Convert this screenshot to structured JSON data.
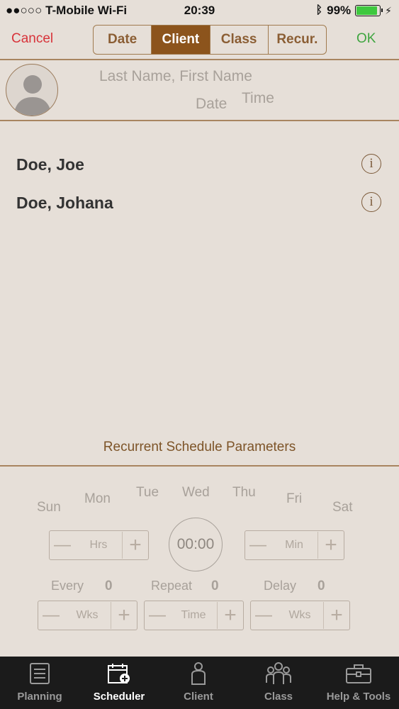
{
  "status_bar": {
    "carrier": "●●○○○ T-Mobile Wi-Fi",
    "time": "20:39",
    "battery": "99%"
  },
  "nav": {
    "cancel": "Cancel",
    "ok": "OK",
    "segments": [
      "Date",
      "Client",
      "Class",
      "Recur."
    ],
    "active_segment": "Client"
  },
  "header": {
    "name_placeholder": "Last Name, First Name",
    "date_placeholder": "Date",
    "time_placeholder": "Time"
  },
  "clients": [
    {
      "name": "Doe, Joe"
    },
    {
      "name": "Doe, Johana"
    }
  ],
  "recurrence": {
    "title": "Recurrent Schedule Parameters",
    "days": [
      "Sun",
      "Mon",
      "Tue",
      "Wed",
      "Thu",
      "Fri",
      "Sat"
    ],
    "clock": "00:00",
    "hrs_label": "Hrs",
    "min_label": "Min",
    "every_label": "Every",
    "every_value": "0",
    "repeat_label": "Repeat",
    "repeat_value": "0",
    "delay_label": "Delay",
    "delay_value": "0",
    "wks_label": "Wks",
    "time_label": "Time"
  },
  "tabs": [
    "Planning",
    "Scheduler",
    "Client",
    "Class",
    "Help & Tools"
  ],
  "active_tab": "Scheduler",
  "colors": {
    "accent": "#8c541c",
    "cancel": "#d8333a",
    "ok": "#3fa53f",
    "background": "#e6dfd8"
  }
}
